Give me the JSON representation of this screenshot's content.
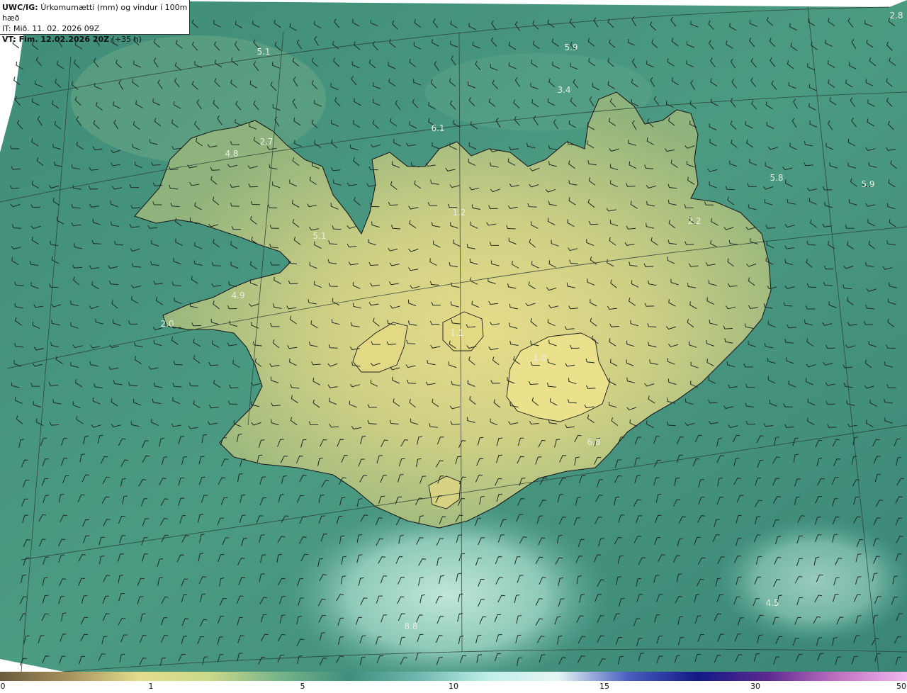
{
  "header": {
    "product": "UWC/IG:",
    "description": "Úrkomumætti (mm) og vindur í 100m hæð",
    "issue_time": "IT: Mið. 11. 02. 2026 09Z",
    "valid_prefix": "VT: Fim. 12.02.2026 20Z",
    "valid_suffix": "(+35 h)"
  },
  "value_labels": [
    "5.1",
    "5.9",
    "3.4",
    "6.1",
    "4.8",
    "2.7",
    "5.8",
    "5.9",
    "2.2",
    "5.1",
    "4.9",
    "2.0",
    "1.1",
    "1.0",
    "2.8",
    "1.2",
    "4.5",
    "8.8",
    "6.8"
  ],
  "colorbar": {
    "ticks": [
      "0",
      "1",
      "5",
      "10",
      "15",
      "30",
      "50"
    ],
    "colors": [
      "#6b5a3a",
      "#a7935e",
      "#e4dc8c",
      "#c9d98a",
      "#78b48a",
      "#3e8f7c",
      "#6fb8b0",
      "#bfeee8",
      "#e6f6f4",
      "#4a5fbf",
      "#121a86",
      "#5b2a8e",
      "#c070c0",
      "#f2b8ee"
    ]
  },
  "wind_barbs_label": "wind-barbs"
}
